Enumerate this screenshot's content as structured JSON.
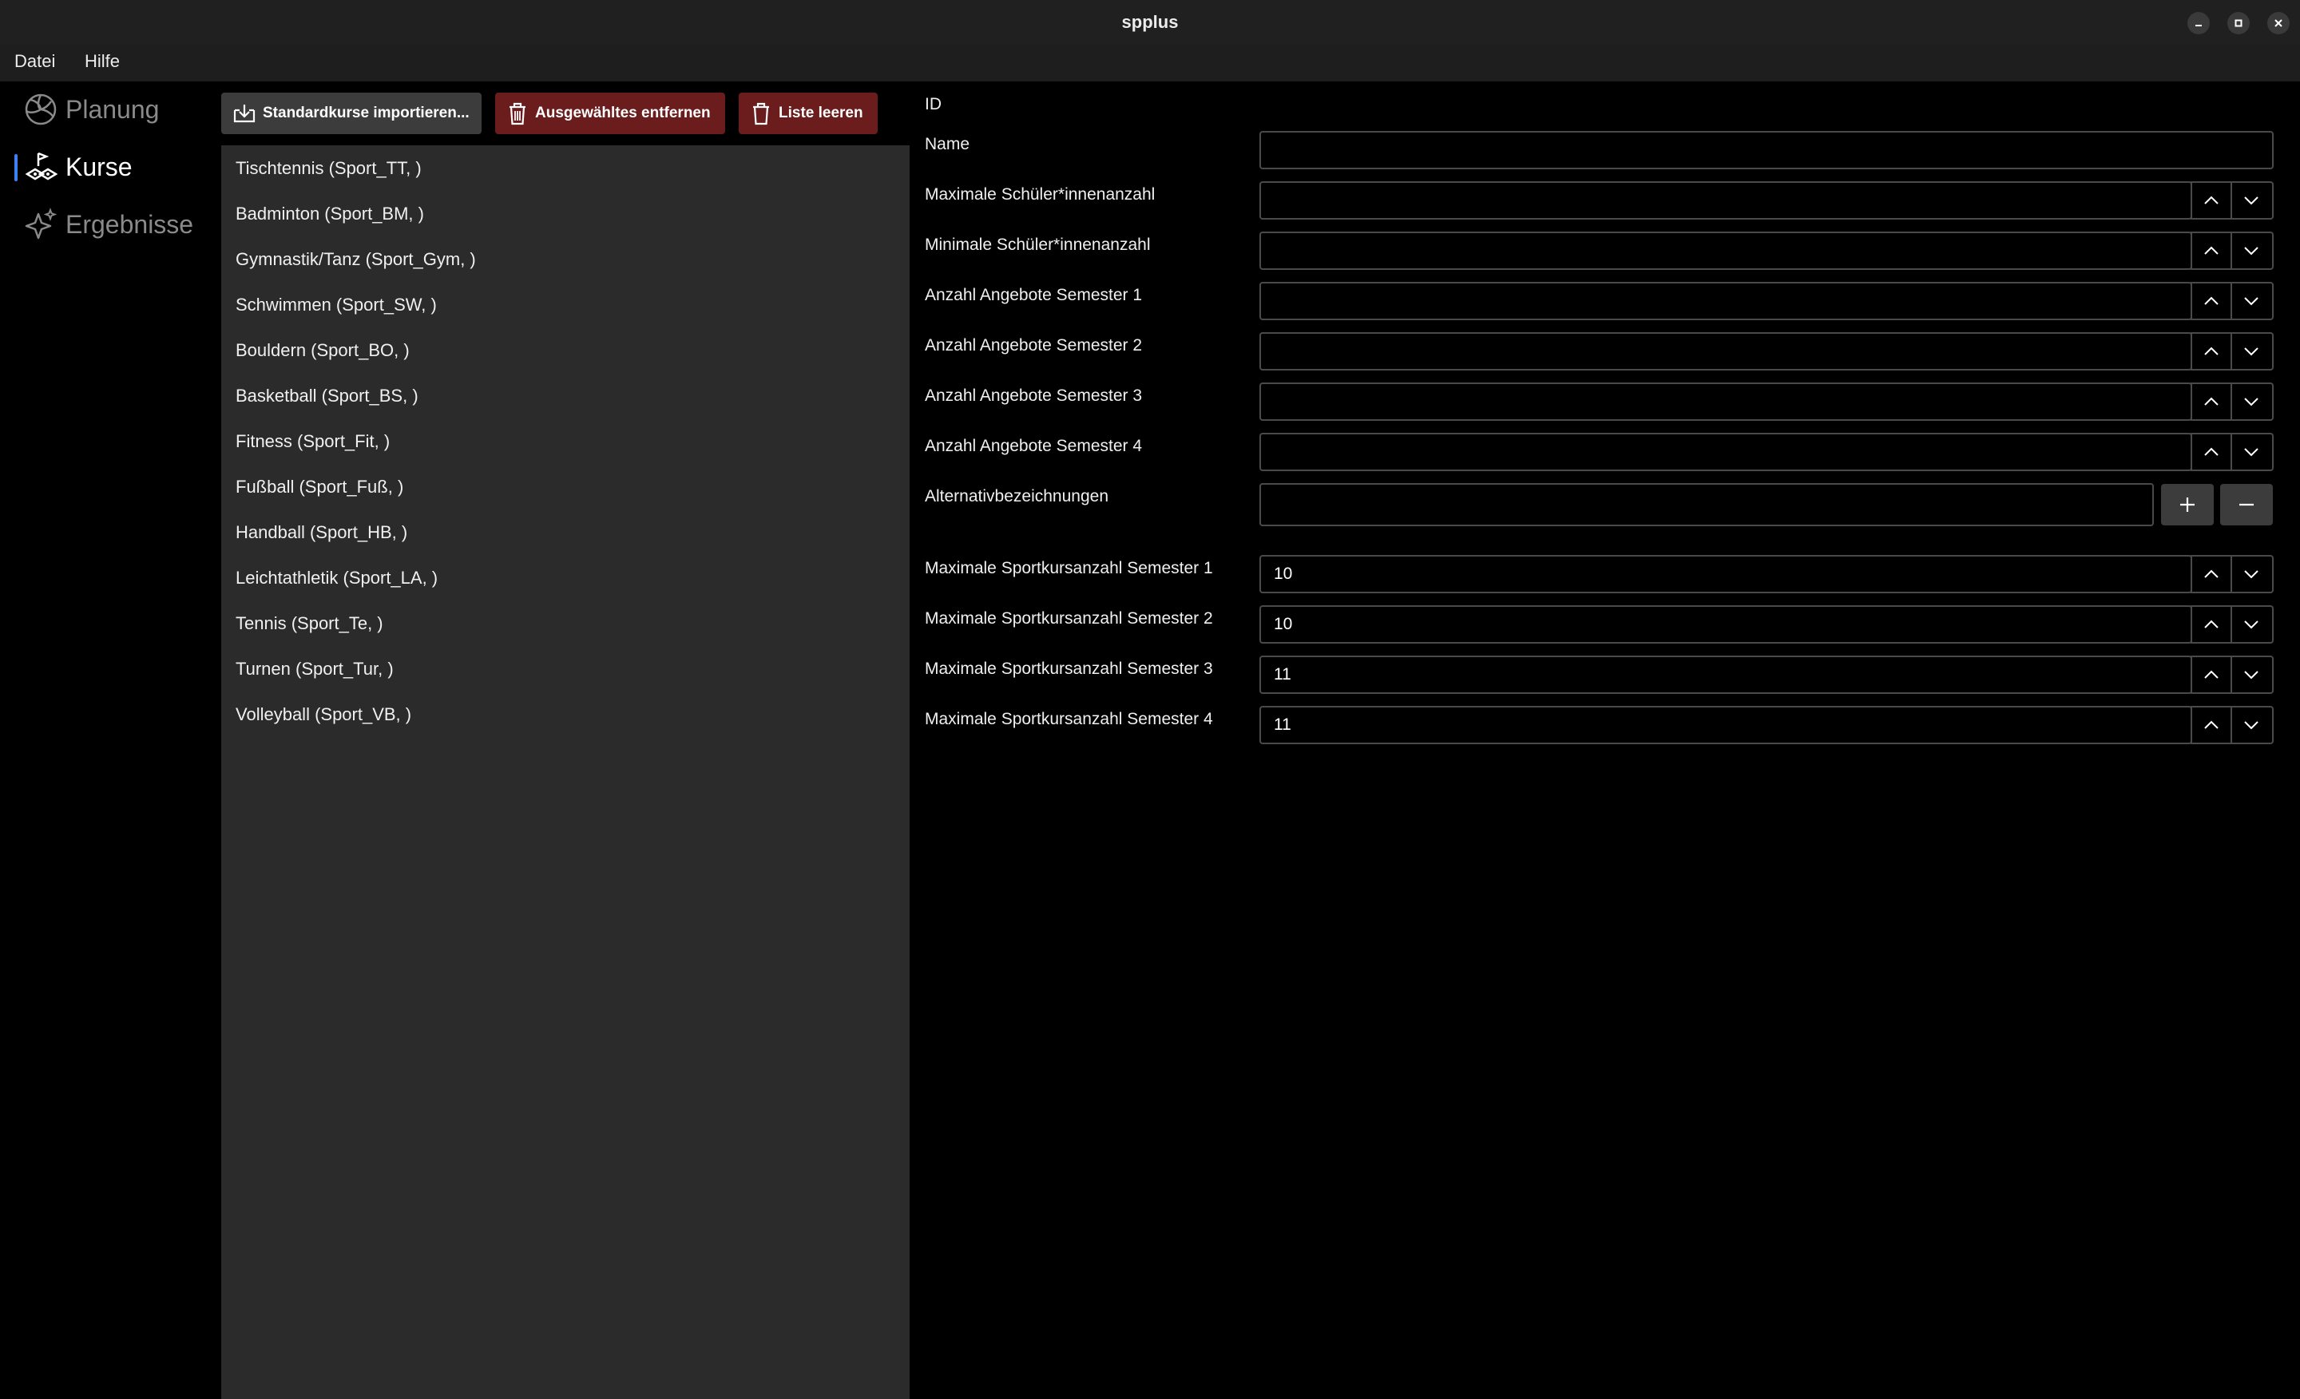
{
  "window": {
    "title": "spplus"
  },
  "menubar": {
    "items": [
      "Datei",
      "Hilfe"
    ]
  },
  "sidebar": {
    "items": [
      {
        "label": "Planung",
        "icon": "volleyball-icon",
        "active": false
      },
      {
        "label": "Kurse",
        "icon": "cones-icon",
        "active": true
      },
      {
        "label": "Ergebnisse",
        "icon": "sparkle-icon",
        "active": false
      }
    ],
    "accent": "#3b82f6"
  },
  "toolbar": {
    "import_label": "Standardkurse importieren...",
    "remove_label": "Ausgewähltes entfernen",
    "clear_label": "Liste leeren",
    "danger_color": "#6b1d1d"
  },
  "courses": [
    "Tischtennis (Sport_TT, )",
    "Badminton (Sport_BM, )",
    "Gymnastik/Tanz (Sport_Gym, )",
    "Schwimmen (Sport_SW, )",
    "Bouldern (Sport_BO, )",
    "Basketball (Sport_BS, )",
    "Fitness (Sport_Fit, )",
    "Fußball (Sport_Fuß, )",
    "Handball (Sport_HB, )",
    "Leichtathletik (Sport_LA, )",
    "Tennis (Sport_Te, )",
    "Turnen (Sport_Tur, )",
    "Volleyball (Sport_VB, )"
  ],
  "form": {
    "id_label": "ID",
    "name_label": "Name",
    "name_value": "",
    "course_fields": [
      {
        "label": "Maximale Schüler*innenanzahl",
        "value": ""
      },
      {
        "label": "Minimale Schüler*innenanzahl",
        "value": ""
      },
      {
        "label": "Anzahl Angebote Semester 1",
        "value": ""
      },
      {
        "label": "Anzahl Angebote Semester 2",
        "value": ""
      },
      {
        "label": "Anzahl Angebote Semester 3",
        "value": ""
      },
      {
        "label": "Anzahl Angebote Semester 4",
        "value": ""
      }
    ],
    "alt_label": "Alternativbezeichnungen",
    "alt_value": "",
    "max_fields": [
      {
        "label": "Maximale Sportkursanzahl Semester 1",
        "value": "10"
      },
      {
        "label": "Maximale Sportkursanzahl Semester 2",
        "value": "10"
      },
      {
        "label": "Maximale Sportkursanzahl Semester 3",
        "value": "11"
      },
      {
        "label": "Maximale Sportkursanzahl Semester 4",
        "value": "11"
      }
    ]
  }
}
